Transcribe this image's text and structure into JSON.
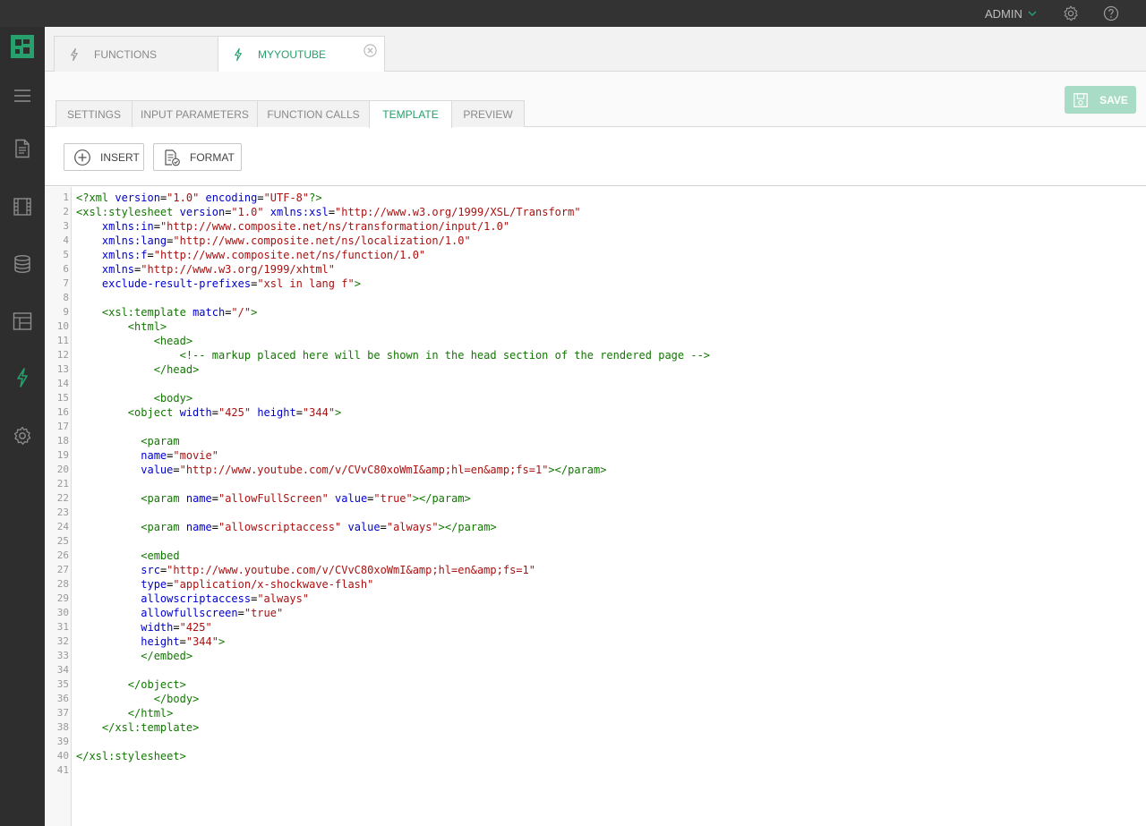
{
  "user": {
    "name": "ADMIN"
  },
  "icons": {
    "accent": "#26a06c",
    "settings": "gear-icon",
    "help": "question-icon"
  },
  "rail": {
    "items": [
      "menu-icon",
      "page-icon",
      "media-icon",
      "data-icon",
      "layout-icon",
      "function-icon",
      "settings-icon"
    ]
  },
  "doc_tabs": [
    {
      "label": "FUNCTIONS"
    },
    {
      "label": "MYYOUTUBE"
    }
  ],
  "sub_tabs": [
    {
      "label": "SETTINGS"
    },
    {
      "label": "INPUT PARAMETERS"
    },
    {
      "label": "FUNCTION CALLS"
    },
    {
      "label": "TEMPLATE"
    },
    {
      "label": "PREVIEW"
    }
  ],
  "toolbar": {
    "insert_label": "INSERT",
    "format_label": "FORMAT",
    "save_label": "SAVE"
  },
  "editor": {
    "lines": [
      "<?xml version=\"1.0\" encoding=\"UTF-8\"?>",
      "<xsl:stylesheet version=\"1.0\" xmlns:xsl=\"http://www.w3.org/1999/XSL/Transform\"",
      "    xmlns:in=\"http://www.composite.net/ns/transformation/input/1.0\"",
      "    xmlns:lang=\"http://www.composite.net/ns/localization/1.0\"",
      "    xmlns:f=\"http://www.composite.net/ns/function/1.0\"",
      "    xmlns=\"http://www.w3.org/1999/xhtml\"",
      "    exclude-result-prefixes=\"xsl in lang f\">",
      "",
      "    <xsl:template match=\"/\">",
      "        <html>",
      "            <head>",
      "                <!-- markup placed here will be shown in the head section of the rendered page -->",
      "            </head>",
      "",
      "            <body>",
      "        <object width=\"425\" height=\"344\">",
      "",
      "          <param",
      "          name=\"movie\"",
      "          value=\"http://www.youtube.com/v/CVvC80xoWmI&amp;hl=en&amp;fs=1\"></param>",
      "",
      "          <param name=\"allowFullScreen\" value=\"true\"></param>",
      "",
      "          <param name=\"allowscriptaccess\" value=\"always\"></param>",
      "",
      "          <embed",
      "          src=\"http://www.youtube.com/v/CVvC80xoWmI&amp;hl=en&amp;fs=1\"",
      "          type=\"application/x-shockwave-flash\"",
      "          allowscriptaccess=\"always\"",
      "          allowfullscreen=\"true\"",
      "          width=\"425\"",
      "          height=\"344\">",
      "          </embed>",
      "",
      "        </object>",
      "            </body>",
      "        </html>",
      "    </xsl:template>",
      "",
      "</xsl:stylesheet>",
      ""
    ]
  }
}
